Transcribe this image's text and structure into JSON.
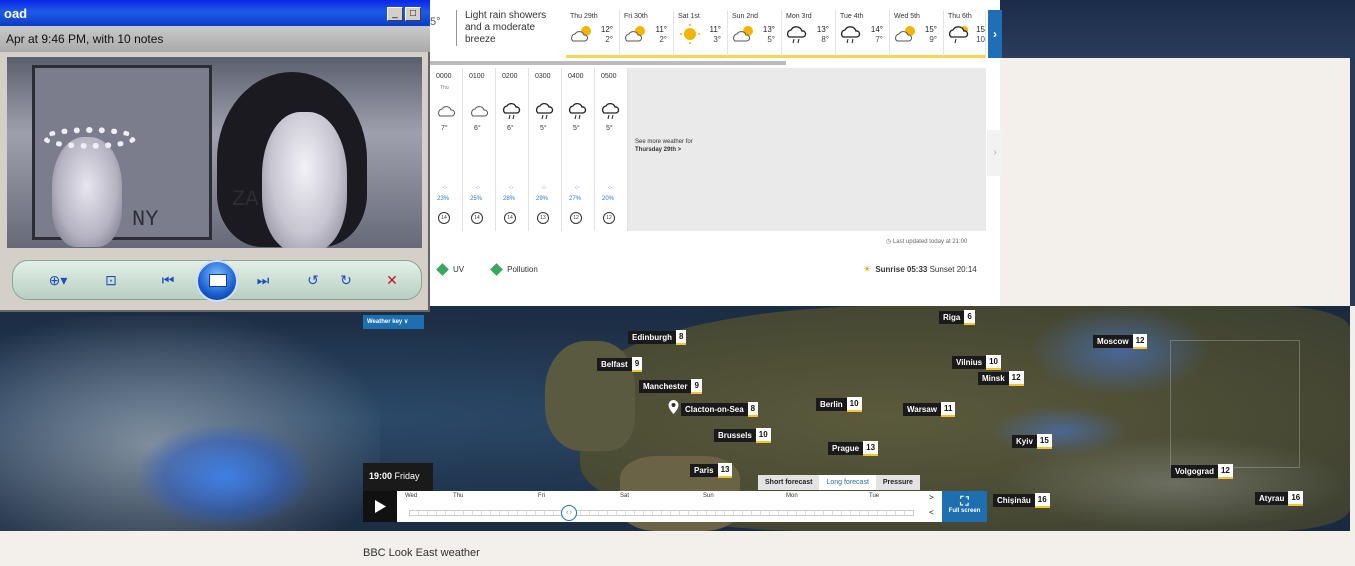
{
  "window": {
    "title": "oad",
    "info": "Apr at 9:46 PM, with 10 notes",
    "minimize": "_",
    "maximize": "□",
    "photo_text_1": "NY",
    "photo_text_2": "ZA",
    "controls": {
      "zoom": "⊕▾",
      "actual_size": "⊡",
      "previous": "⏮",
      "next": "⏭",
      "rotate_ccw": "↺",
      "rotate_cw": "↻",
      "delete": "✕"
    }
  },
  "summary": {
    "temp_cut": "5°",
    "text": "Light rain showers and a moderate breeze"
  },
  "days": [
    {
      "label": "Thu 29th",
      "hi": "12°",
      "lo": "2°",
      "icon": "sunny-cloud-icon"
    },
    {
      "label": "Fri 30th",
      "hi": "11°",
      "lo": "2°",
      "icon": "sunny-cloud-icon"
    },
    {
      "label": "Sat 1st",
      "hi": "11°",
      "lo": "3°",
      "icon": "sun-icon"
    },
    {
      "label": "Sun 2nd",
      "hi": "13°",
      "lo": "5°",
      "icon": "sunny-cloud-icon"
    },
    {
      "label": "Mon 3rd",
      "hi": "13°",
      "lo": "8°",
      "icon": "rain-cloud-icon"
    },
    {
      "label": "Tue 4th",
      "hi": "14°",
      "lo": "7°",
      "icon": "rain-cloud-icon"
    },
    {
      "label": "Wed 5th",
      "hi": "15°",
      "lo": "9°",
      "icon": "sunny-cloud-icon"
    },
    {
      "label": "Thu 6th",
      "hi": "15",
      "lo": "10",
      "icon": "sunny-rain-icon"
    }
  ],
  "day_next": "›",
  "hours": [
    {
      "time": "0000",
      "sub": "Thu",
      "temp": "7°",
      "rain": "23%",
      "wind": "14",
      "icon": "cloud-icon"
    },
    {
      "time": "0100",
      "sub": "",
      "temp": "6°",
      "rain": "25%",
      "wind": "14",
      "icon": "cloud-icon"
    },
    {
      "time": "0200",
      "sub": "",
      "temp": "6°",
      "rain": "28%",
      "wind": "14",
      "icon": "rain-cloud-icon"
    },
    {
      "time": "0300",
      "sub": "",
      "temp": "5°",
      "rain": "29%",
      "wind": "13",
      "icon": "rain-cloud-icon"
    },
    {
      "time": "0400",
      "sub": "",
      "temp": "5°",
      "rain": "27%",
      "wind": "12",
      "icon": "rain-cloud-icon"
    },
    {
      "time": "0500",
      "sub": "",
      "temp": "5°",
      "rain": "20%",
      "wind": "12",
      "icon": "rain-cloud-icon"
    }
  ],
  "more": {
    "line1": "See more weather for",
    "line2": "Thursday 29th >"
  },
  "updated": "Last updated today at 21:00",
  "uv": "UV",
  "pollution": "Pollution",
  "sunrise": "Sunrise 05:33",
  "sunset": "Sunset 20:14",
  "weather_key": "Weather key ∨",
  "cities": [
    {
      "name": "Edinburgh",
      "temp": "8"
    },
    {
      "name": "Belfast",
      "temp": "9"
    },
    {
      "name": "Manchester",
      "temp": "9"
    },
    {
      "name": "Clacton-on-Sea",
      "temp": "8"
    },
    {
      "name": "Brussels",
      "temp": "10"
    },
    {
      "name": "Paris",
      "temp": "13"
    },
    {
      "name": "Berlin",
      "temp": "10"
    },
    {
      "name": "Prague",
      "temp": "13"
    },
    {
      "name": "Warsaw",
      "temp": "11"
    },
    {
      "name": "Riga",
      "temp": "6"
    },
    {
      "name": "Vilnius",
      "temp": "10"
    },
    {
      "name": "Minsk",
      "temp": "12"
    },
    {
      "name": "Moscow",
      "temp": "12"
    },
    {
      "name": "Kyiv",
      "temp": "15"
    },
    {
      "name": "Volgograd",
      "temp": "12"
    },
    {
      "name": "Chișinău",
      "temp": "16"
    },
    {
      "name": "Atyrau",
      "temp": "16"
    }
  ],
  "time_box": {
    "time": "19:00",
    "day": "Friday"
  },
  "tabs": [
    "Short forecast",
    "Long forecast",
    "Pressure"
  ],
  "timeline_days": [
    "Wed",
    "Thu",
    "Fri",
    "Sat",
    "Sun",
    "Mon",
    "Tue"
  ],
  "timeline_knob": "‹ ›",
  "timeline_nav": {
    "next": ">",
    "prev": "<"
  },
  "fullscreen": "Full screen",
  "caption": "BBC Look East weather"
}
